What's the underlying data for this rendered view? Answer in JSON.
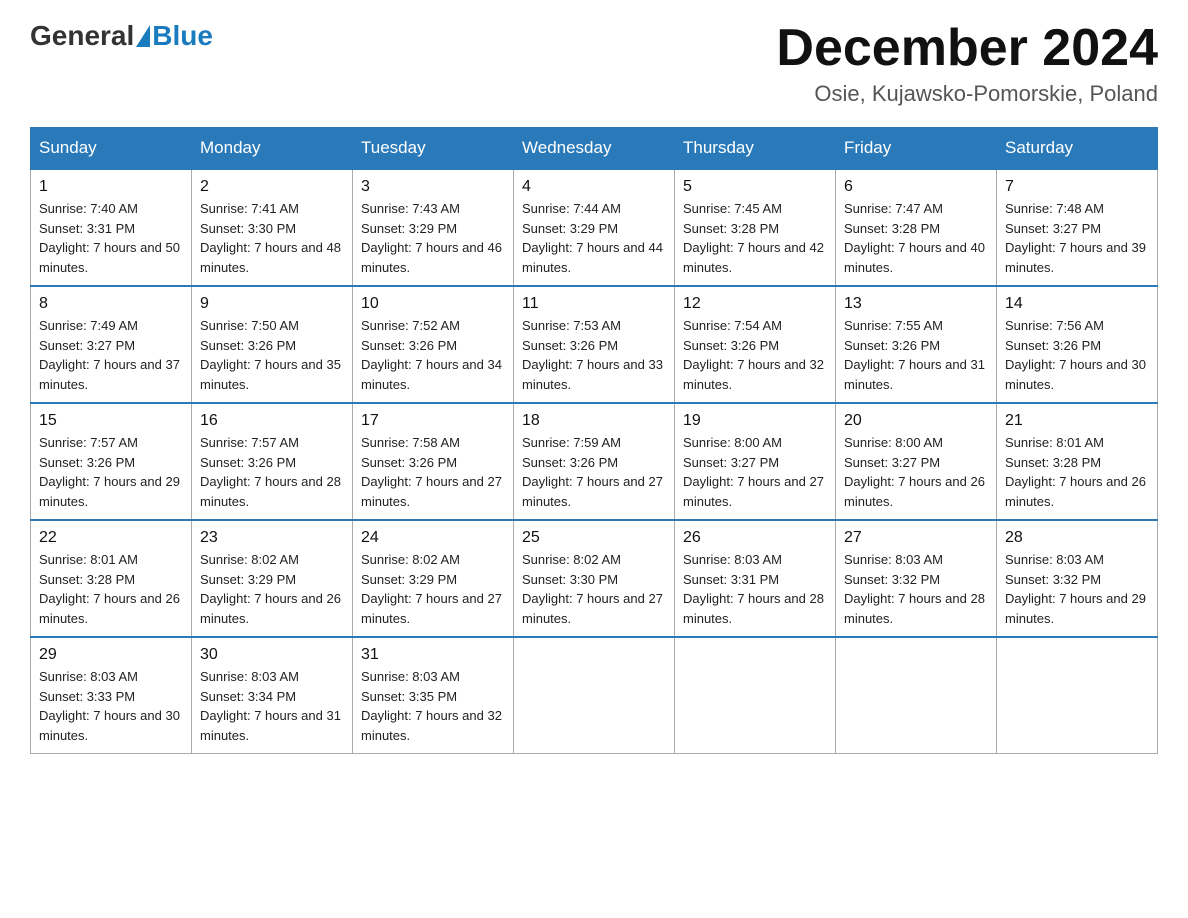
{
  "header": {
    "logo": {
      "general": "General",
      "blue": "Blue"
    },
    "title": "December 2024",
    "location": "Osie, Kujawsko-Pomorskie, Poland"
  },
  "weekdays": [
    "Sunday",
    "Monday",
    "Tuesday",
    "Wednesday",
    "Thursday",
    "Friday",
    "Saturday"
  ],
  "weeks": [
    [
      {
        "day": 1,
        "sunrise": "7:40 AM",
        "sunset": "3:31 PM",
        "daylight": "7 hours and 50 minutes."
      },
      {
        "day": 2,
        "sunrise": "7:41 AM",
        "sunset": "3:30 PM",
        "daylight": "7 hours and 48 minutes."
      },
      {
        "day": 3,
        "sunrise": "7:43 AM",
        "sunset": "3:29 PM",
        "daylight": "7 hours and 46 minutes."
      },
      {
        "day": 4,
        "sunrise": "7:44 AM",
        "sunset": "3:29 PM",
        "daylight": "7 hours and 44 minutes."
      },
      {
        "day": 5,
        "sunrise": "7:45 AM",
        "sunset": "3:28 PM",
        "daylight": "7 hours and 42 minutes."
      },
      {
        "day": 6,
        "sunrise": "7:47 AM",
        "sunset": "3:28 PM",
        "daylight": "7 hours and 40 minutes."
      },
      {
        "day": 7,
        "sunrise": "7:48 AM",
        "sunset": "3:27 PM",
        "daylight": "7 hours and 39 minutes."
      }
    ],
    [
      {
        "day": 8,
        "sunrise": "7:49 AM",
        "sunset": "3:27 PM",
        "daylight": "7 hours and 37 minutes."
      },
      {
        "day": 9,
        "sunrise": "7:50 AM",
        "sunset": "3:26 PM",
        "daylight": "7 hours and 35 minutes."
      },
      {
        "day": 10,
        "sunrise": "7:52 AM",
        "sunset": "3:26 PM",
        "daylight": "7 hours and 34 minutes."
      },
      {
        "day": 11,
        "sunrise": "7:53 AM",
        "sunset": "3:26 PM",
        "daylight": "7 hours and 33 minutes."
      },
      {
        "day": 12,
        "sunrise": "7:54 AM",
        "sunset": "3:26 PM",
        "daylight": "7 hours and 32 minutes."
      },
      {
        "day": 13,
        "sunrise": "7:55 AM",
        "sunset": "3:26 PM",
        "daylight": "7 hours and 31 minutes."
      },
      {
        "day": 14,
        "sunrise": "7:56 AM",
        "sunset": "3:26 PM",
        "daylight": "7 hours and 30 minutes."
      }
    ],
    [
      {
        "day": 15,
        "sunrise": "7:57 AM",
        "sunset": "3:26 PM",
        "daylight": "7 hours and 29 minutes."
      },
      {
        "day": 16,
        "sunrise": "7:57 AM",
        "sunset": "3:26 PM",
        "daylight": "7 hours and 28 minutes."
      },
      {
        "day": 17,
        "sunrise": "7:58 AM",
        "sunset": "3:26 PM",
        "daylight": "7 hours and 27 minutes."
      },
      {
        "day": 18,
        "sunrise": "7:59 AM",
        "sunset": "3:26 PM",
        "daylight": "7 hours and 27 minutes."
      },
      {
        "day": 19,
        "sunrise": "8:00 AM",
        "sunset": "3:27 PM",
        "daylight": "7 hours and 27 minutes."
      },
      {
        "day": 20,
        "sunrise": "8:00 AM",
        "sunset": "3:27 PM",
        "daylight": "7 hours and 26 minutes."
      },
      {
        "day": 21,
        "sunrise": "8:01 AM",
        "sunset": "3:28 PM",
        "daylight": "7 hours and 26 minutes."
      }
    ],
    [
      {
        "day": 22,
        "sunrise": "8:01 AM",
        "sunset": "3:28 PM",
        "daylight": "7 hours and 26 minutes."
      },
      {
        "day": 23,
        "sunrise": "8:02 AM",
        "sunset": "3:29 PM",
        "daylight": "7 hours and 26 minutes."
      },
      {
        "day": 24,
        "sunrise": "8:02 AM",
        "sunset": "3:29 PM",
        "daylight": "7 hours and 27 minutes."
      },
      {
        "day": 25,
        "sunrise": "8:02 AM",
        "sunset": "3:30 PM",
        "daylight": "7 hours and 27 minutes."
      },
      {
        "day": 26,
        "sunrise": "8:03 AM",
        "sunset": "3:31 PM",
        "daylight": "7 hours and 28 minutes."
      },
      {
        "day": 27,
        "sunrise": "8:03 AM",
        "sunset": "3:32 PM",
        "daylight": "7 hours and 28 minutes."
      },
      {
        "day": 28,
        "sunrise": "8:03 AM",
        "sunset": "3:32 PM",
        "daylight": "7 hours and 29 minutes."
      }
    ],
    [
      {
        "day": 29,
        "sunrise": "8:03 AM",
        "sunset": "3:33 PM",
        "daylight": "7 hours and 30 minutes."
      },
      {
        "day": 30,
        "sunrise": "8:03 AM",
        "sunset": "3:34 PM",
        "daylight": "7 hours and 31 minutes."
      },
      {
        "day": 31,
        "sunrise": "8:03 AM",
        "sunset": "3:35 PM",
        "daylight": "7 hours and 32 minutes."
      },
      null,
      null,
      null,
      null
    ]
  ]
}
